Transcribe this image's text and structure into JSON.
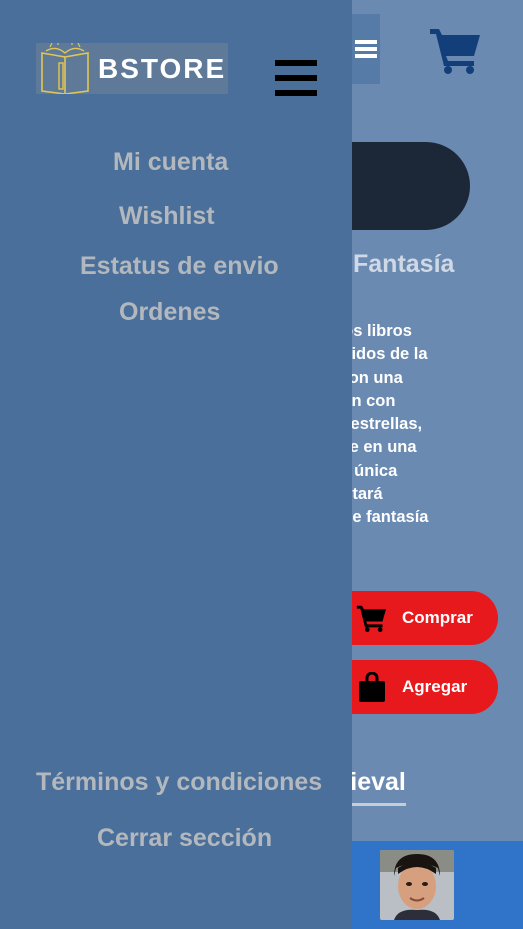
{
  "logo": {
    "text": "BSTORE"
  },
  "drawer": {
    "menu": [
      "Mi cuenta",
      "Wishlist",
      "Estatus de envio",
      "Ordenes"
    ],
    "footer_links": [
      "Términos y condiciones",
      "Cerrar sección"
    ]
  },
  "page": {
    "genre": "Fantasía",
    "description": "no de los libros\nás vendidos de la\nstoria con una\nlificación con\nás de 5 estrellas,\n sumerge en una\nventura única\nonde estará\nenada de fantasía\nacción.",
    "buy_label": "Comprar",
    "add_label": "Agregar",
    "section_title": "dieval"
  },
  "icons": [
    "menu-icon",
    "cart-icon",
    "shopping-bag-icon",
    "book-logo-icon"
  ],
  "colors": {
    "drawer_bg": "#4a6f9a",
    "page_bg": "#6a8ab2",
    "accent_red": "#e8191d",
    "cart_blue": "#123f7a",
    "bottom_bar": "#2f74c8"
  }
}
